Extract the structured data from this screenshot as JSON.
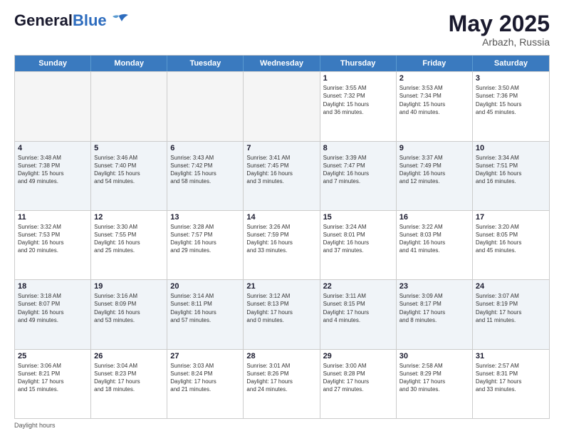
{
  "header": {
    "logo_general": "General",
    "logo_blue": "Blue",
    "month_year": "May 2025",
    "location": "Arbazh, Russia"
  },
  "days_of_week": [
    "Sunday",
    "Monday",
    "Tuesday",
    "Wednesday",
    "Thursday",
    "Friday",
    "Saturday"
  ],
  "weeks": [
    [
      {
        "day": "",
        "info": ""
      },
      {
        "day": "",
        "info": ""
      },
      {
        "day": "",
        "info": ""
      },
      {
        "day": "",
        "info": ""
      },
      {
        "day": "1",
        "info": "Sunrise: 3:55 AM\nSunset: 7:32 PM\nDaylight: 15 hours\nand 36 minutes."
      },
      {
        "day": "2",
        "info": "Sunrise: 3:53 AM\nSunset: 7:34 PM\nDaylight: 15 hours\nand 40 minutes."
      },
      {
        "day": "3",
        "info": "Sunrise: 3:50 AM\nSunset: 7:36 PM\nDaylight: 15 hours\nand 45 minutes."
      }
    ],
    [
      {
        "day": "4",
        "info": "Sunrise: 3:48 AM\nSunset: 7:38 PM\nDaylight: 15 hours\nand 49 minutes."
      },
      {
        "day": "5",
        "info": "Sunrise: 3:46 AM\nSunset: 7:40 PM\nDaylight: 15 hours\nand 54 minutes."
      },
      {
        "day": "6",
        "info": "Sunrise: 3:43 AM\nSunset: 7:42 PM\nDaylight: 15 hours\nand 58 minutes."
      },
      {
        "day": "7",
        "info": "Sunrise: 3:41 AM\nSunset: 7:45 PM\nDaylight: 16 hours\nand 3 minutes."
      },
      {
        "day": "8",
        "info": "Sunrise: 3:39 AM\nSunset: 7:47 PM\nDaylight: 16 hours\nand 7 minutes."
      },
      {
        "day": "9",
        "info": "Sunrise: 3:37 AM\nSunset: 7:49 PM\nDaylight: 16 hours\nand 12 minutes."
      },
      {
        "day": "10",
        "info": "Sunrise: 3:34 AM\nSunset: 7:51 PM\nDaylight: 16 hours\nand 16 minutes."
      }
    ],
    [
      {
        "day": "11",
        "info": "Sunrise: 3:32 AM\nSunset: 7:53 PM\nDaylight: 16 hours\nand 20 minutes."
      },
      {
        "day": "12",
        "info": "Sunrise: 3:30 AM\nSunset: 7:55 PM\nDaylight: 16 hours\nand 25 minutes."
      },
      {
        "day": "13",
        "info": "Sunrise: 3:28 AM\nSunset: 7:57 PM\nDaylight: 16 hours\nand 29 minutes."
      },
      {
        "day": "14",
        "info": "Sunrise: 3:26 AM\nSunset: 7:59 PM\nDaylight: 16 hours\nand 33 minutes."
      },
      {
        "day": "15",
        "info": "Sunrise: 3:24 AM\nSunset: 8:01 PM\nDaylight: 16 hours\nand 37 minutes."
      },
      {
        "day": "16",
        "info": "Sunrise: 3:22 AM\nSunset: 8:03 PM\nDaylight: 16 hours\nand 41 minutes."
      },
      {
        "day": "17",
        "info": "Sunrise: 3:20 AM\nSunset: 8:05 PM\nDaylight: 16 hours\nand 45 minutes."
      }
    ],
    [
      {
        "day": "18",
        "info": "Sunrise: 3:18 AM\nSunset: 8:07 PM\nDaylight: 16 hours\nand 49 minutes."
      },
      {
        "day": "19",
        "info": "Sunrise: 3:16 AM\nSunset: 8:09 PM\nDaylight: 16 hours\nand 53 minutes."
      },
      {
        "day": "20",
        "info": "Sunrise: 3:14 AM\nSunset: 8:11 PM\nDaylight: 16 hours\nand 57 minutes."
      },
      {
        "day": "21",
        "info": "Sunrise: 3:12 AM\nSunset: 8:13 PM\nDaylight: 17 hours\nand 0 minutes."
      },
      {
        "day": "22",
        "info": "Sunrise: 3:11 AM\nSunset: 8:15 PM\nDaylight: 17 hours\nand 4 minutes."
      },
      {
        "day": "23",
        "info": "Sunrise: 3:09 AM\nSunset: 8:17 PM\nDaylight: 17 hours\nand 8 minutes."
      },
      {
        "day": "24",
        "info": "Sunrise: 3:07 AM\nSunset: 8:19 PM\nDaylight: 17 hours\nand 11 minutes."
      }
    ],
    [
      {
        "day": "25",
        "info": "Sunrise: 3:06 AM\nSunset: 8:21 PM\nDaylight: 17 hours\nand 15 minutes."
      },
      {
        "day": "26",
        "info": "Sunrise: 3:04 AM\nSunset: 8:23 PM\nDaylight: 17 hours\nand 18 minutes."
      },
      {
        "day": "27",
        "info": "Sunrise: 3:03 AM\nSunset: 8:24 PM\nDaylight: 17 hours\nand 21 minutes."
      },
      {
        "day": "28",
        "info": "Sunrise: 3:01 AM\nSunset: 8:26 PM\nDaylight: 17 hours\nand 24 minutes."
      },
      {
        "day": "29",
        "info": "Sunrise: 3:00 AM\nSunset: 8:28 PM\nDaylight: 17 hours\nand 27 minutes."
      },
      {
        "day": "30",
        "info": "Sunrise: 2:58 AM\nSunset: 8:29 PM\nDaylight: 17 hours\nand 30 minutes."
      },
      {
        "day": "31",
        "info": "Sunrise: 2:57 AM\nSunset: 8:31 PM\nDaylight: 17 hours\nand 33 minutes."
      }
    ]
  ],
  "footer": {
    "daylight_hours_label": "Daylight hours"
  }
}
